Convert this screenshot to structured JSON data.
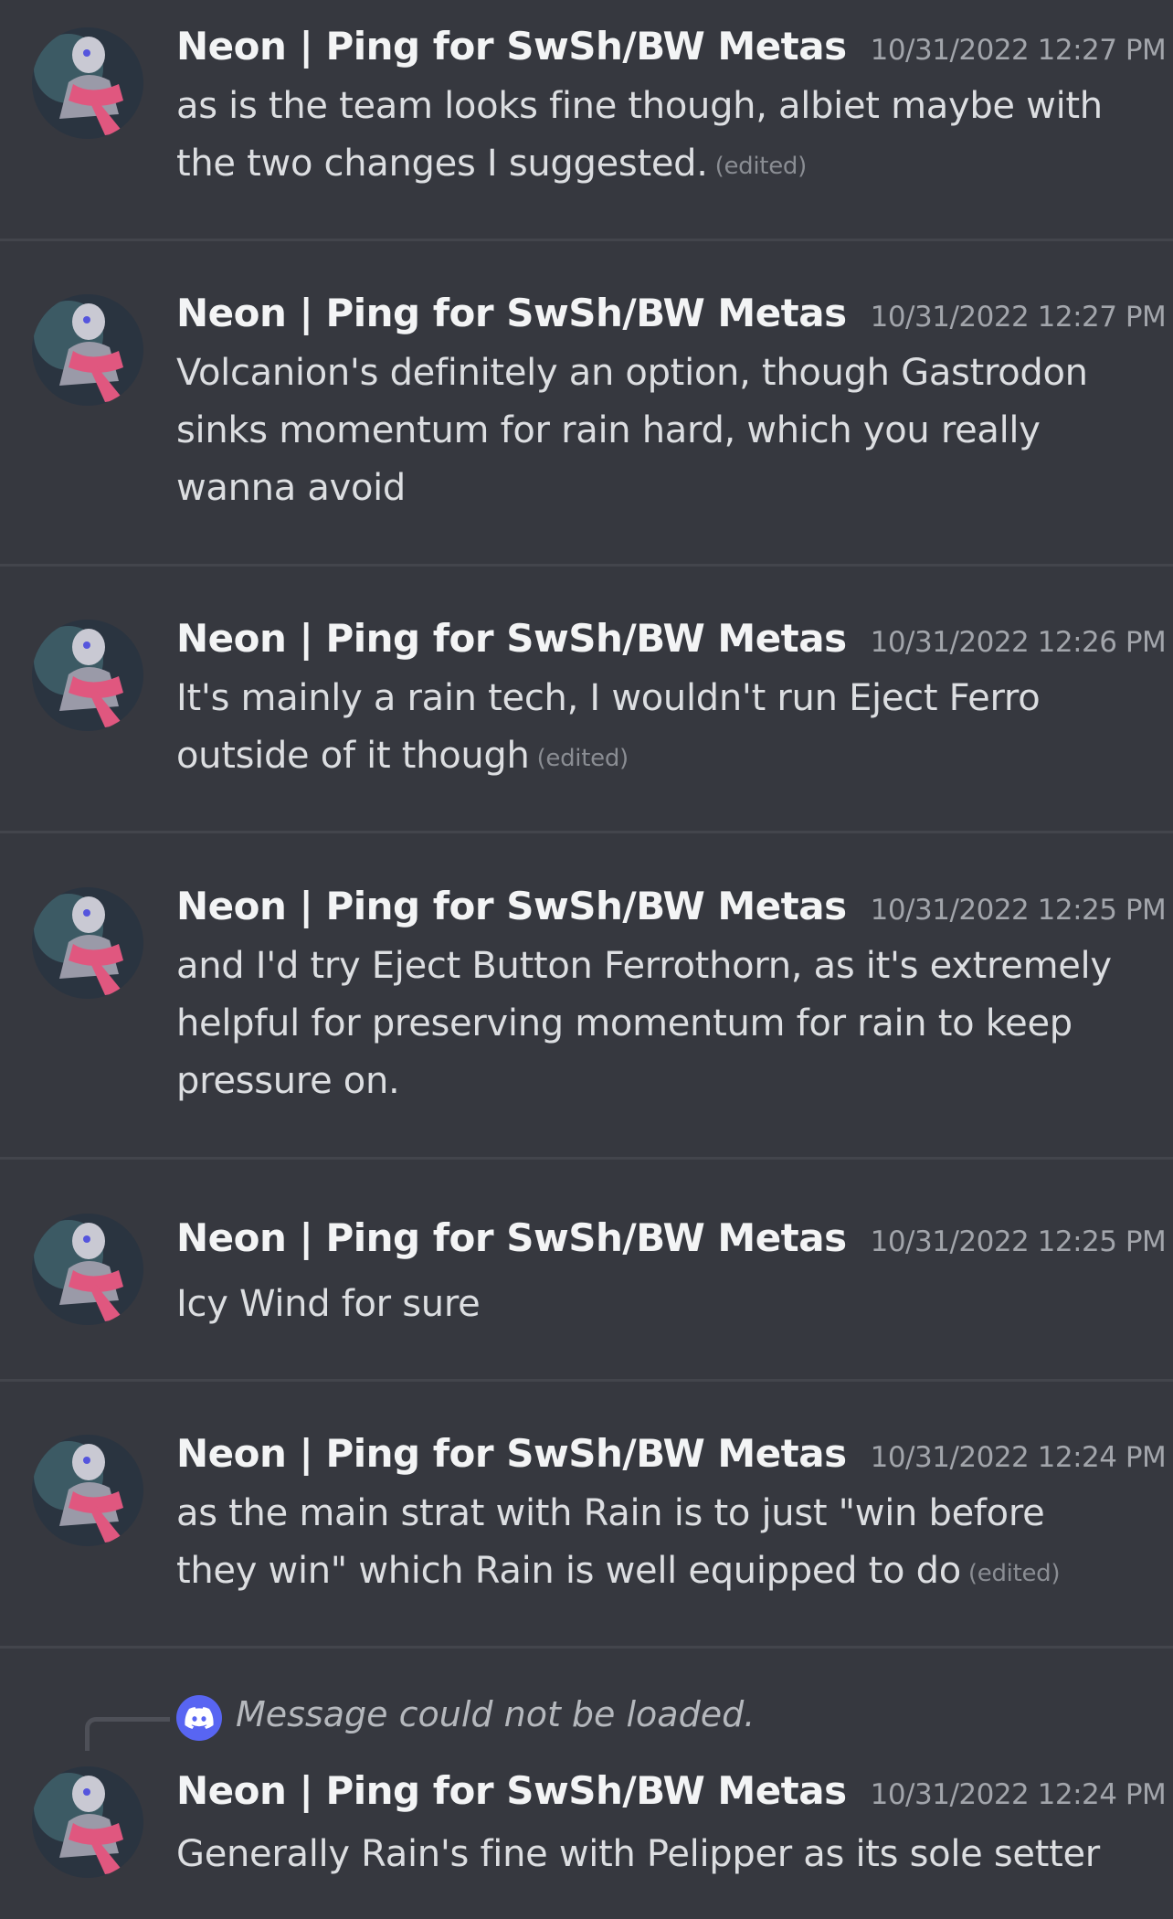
{
  "messages": [
    {
      "author": "Neon | Ping for SwSh/BW Metas",
      "timestamp": "10/31/2022 12:27 PM",
      "lines": [
        "as is the team looks fine though, albiet maybe with",
        "the two changes I suggested."
      ],
      "edited": "(edited)"
    },
    {
      "author": "Neon | Ping for SwSh/BW Metas",
      "timestamp": "10/31/2022 12:27 PM",
      "lines": [
        "Volcanion's definitely an option, though Gastrodon",
        "sinks momentum for rain hard, which you really",
        "wanna avoid"
      ],
      "edited": ""
    },
    {
      "author": "Neon | Ping for SwSh/BW Metas",
      "timestamp": "10/31/2022 12:26 PM",
      "lines": [
        "It's mainly a rain tech, I wouldn't run Eject Ferro",
        "outside of it though"
      ],
      "edited": "(edited)"
    },
    {
      "author": "Neon | Ping for SwSh/BW Metas",
      "timestamp": "10/31/2022 12:25 PM",
      "lines": [
        "and I'd try Eject Button Ferrothorn, as it's extremely",
        "helpful for preserving momentum for rain to keep",
        "pressure on."
      ],
      "edited": ""
    },
    {
      "author": "Neon | Ping for SwSh/BW Metas",
      "timestamp": "10/31/2022 12:25 PM",
      "lines": [
        "Icy Wind for sure"
      ],
      "edited": ""
    },
    {
      "author": "Neon | Ping for SwSh/BW Metas",
      "timestamp": "10/31/2022 12:24 PM",
      "lines": [
        "as the main strat with Rain is to just \"win before",
        "they win\" which Rain is well equipped to do"
      ],
      "edited": "(edited)"
    },
    {
      "author": "Neon | Ping for SwSh/BW Metas",
      "timestamp": "10/31/2022 12:24 PM",
      "lines": [
        "Generally Rain's fine with Pelipper as its sole setter"
      ],
      "edited": "",
      "reply_text": "Message could not be loaded."
    }
  ],
  "icons": {
    "avatar": "user-avatar",
    "reply": "discord-logo-icon"
  },
  "colors": {
    "background": "#36383f",
    "divider": "#43454c",
    "author": "#f3f4f5",
    "text": "#dcdee1",
    "timestamp": "#a2a5ab",
    "edited": "#8a8d93",
    "reply_accent": "#5865f2"
  }
}
